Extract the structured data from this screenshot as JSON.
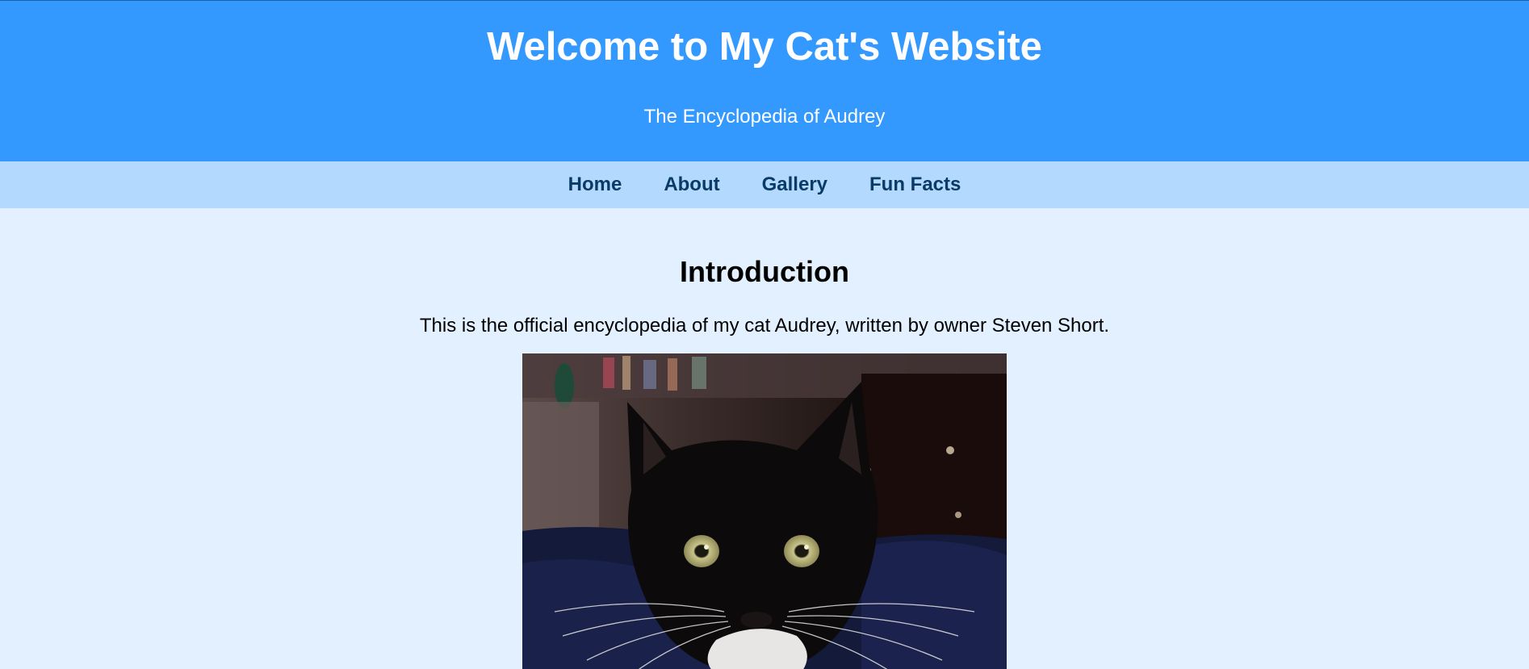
{
  "header": {
    "title": "Welcome to My Cat's Website",
    "subtitle": "The Encyclopedia of Audrey"
  },
  "nav": {
    "items": [
      {
        "label": "Home"
      },
      {
        "label": "About"
      },
      {
        "label": "Gallery"
      },
      {
        "label": "Fun Facts"
      }
    ]
  },
  "main": {
    "heading": "Introduction",
    "intro": "This is the official encyclopedia of my cat Audrey, written by owner Steven Short.",
    "photo": {
      "subject": "black-and-white tuxedo cat"
    }
  },
  "colors": {
    "header_bg": "#3399ff",
    "nav_bg": "#b3d9ff",
    "page_bg": "#e3f0ff",
    "nav_text": "#0a3a66"
  }
}
